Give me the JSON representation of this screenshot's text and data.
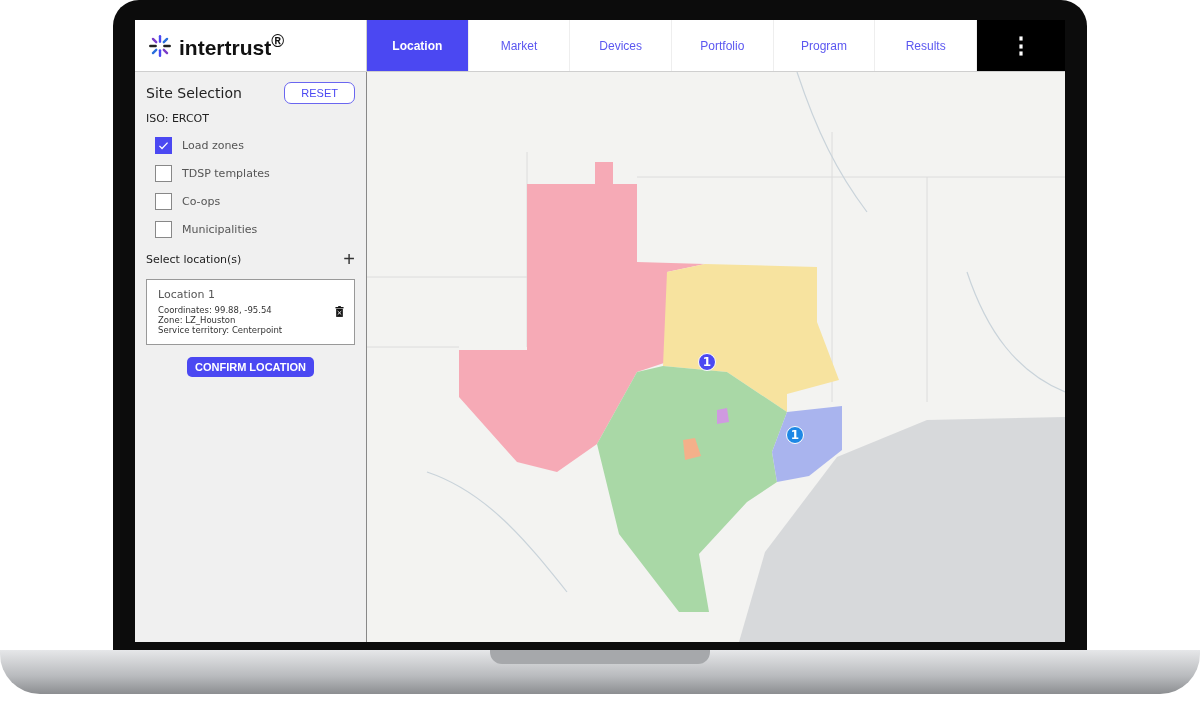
{
  "logo": {
    "text": "intertrust$^{®}$"
  },
  "tabs": [
    {
      "label": "Location",
      "selected": true
    },
    {
      "label": "Market",
      "selected": false
    },
    {
      "label": "Devices",
      "selected": false
    },
    {
      "label": "Portfolio",
      "selected": false
    },
    {
      "label": "Program",
      "selected": false
    },
    {
      "label": "Results",
      "selected": false
    }
  ],
  "more_button": {
    "label": "⋮"
  },
  "sidebar": {
    "title": "Site Selection",
    "reset_button": "RESET",
    "iso": "ISO: ERCOT",
    "layers": [
      {
        "label": "Load zones",
        "checked": true
      },
      {
        "label": "TDSP templates",
        "checked": false
      },
      {
        "label": "Co-ops",
        "checked": false
      },
      {
        "label": "Municipalities",
        "checked": false
      }
    ],
    "locations_heading": "Select location(s)",
    "add_button": "+",
    "locations": [
      {
        "title": "Location 1",
        "lines": [
          "Coordinates: 99.88, -95.54",
          "Zone: LZ_Houston",
          "Service territory: Centerpoint"
        ]
      }
    ],
    "confirm_button": "CONFIRM LOCATION"
  },
  "map": {
    "kind": "picture",
    "markers": [
      {
        "label": "1",
        "color": "#4b48f2"
      },
      {
        "label": "1",
        "color": "#1e88e5"
      }
    ]
  }
}
